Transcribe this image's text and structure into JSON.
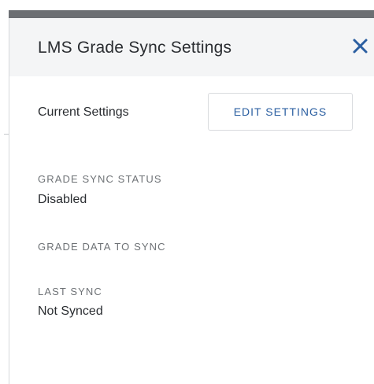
{
  "panel": {
    "title": "LMS Grade Sync Settings",
    "close_icon": "close-icon"
  },
  "current_settings": {
    "label": "Current Settings",
    "edit_button_label": "EDIT SETTINGS"
  },
  "fields": {
    "grade_sync_status": {
      "label": "GRADE SYNC STATUS",
      "value": "Disabled"
    },
    "grade_data_to_sync": {
      "label": "GRADE DATA TO SYNC",
      "value": ""
    },
    "last_sync": {
      "label": "LAST SYNC",
      "value": "Not Synced"
    }
  },
  "colors": {
    "accent": "#2b5fa1",
    "header_bg": "#f4f5f6",
    "text": "#2a2d31",
    "muted": "#6e7276"
  }
}
